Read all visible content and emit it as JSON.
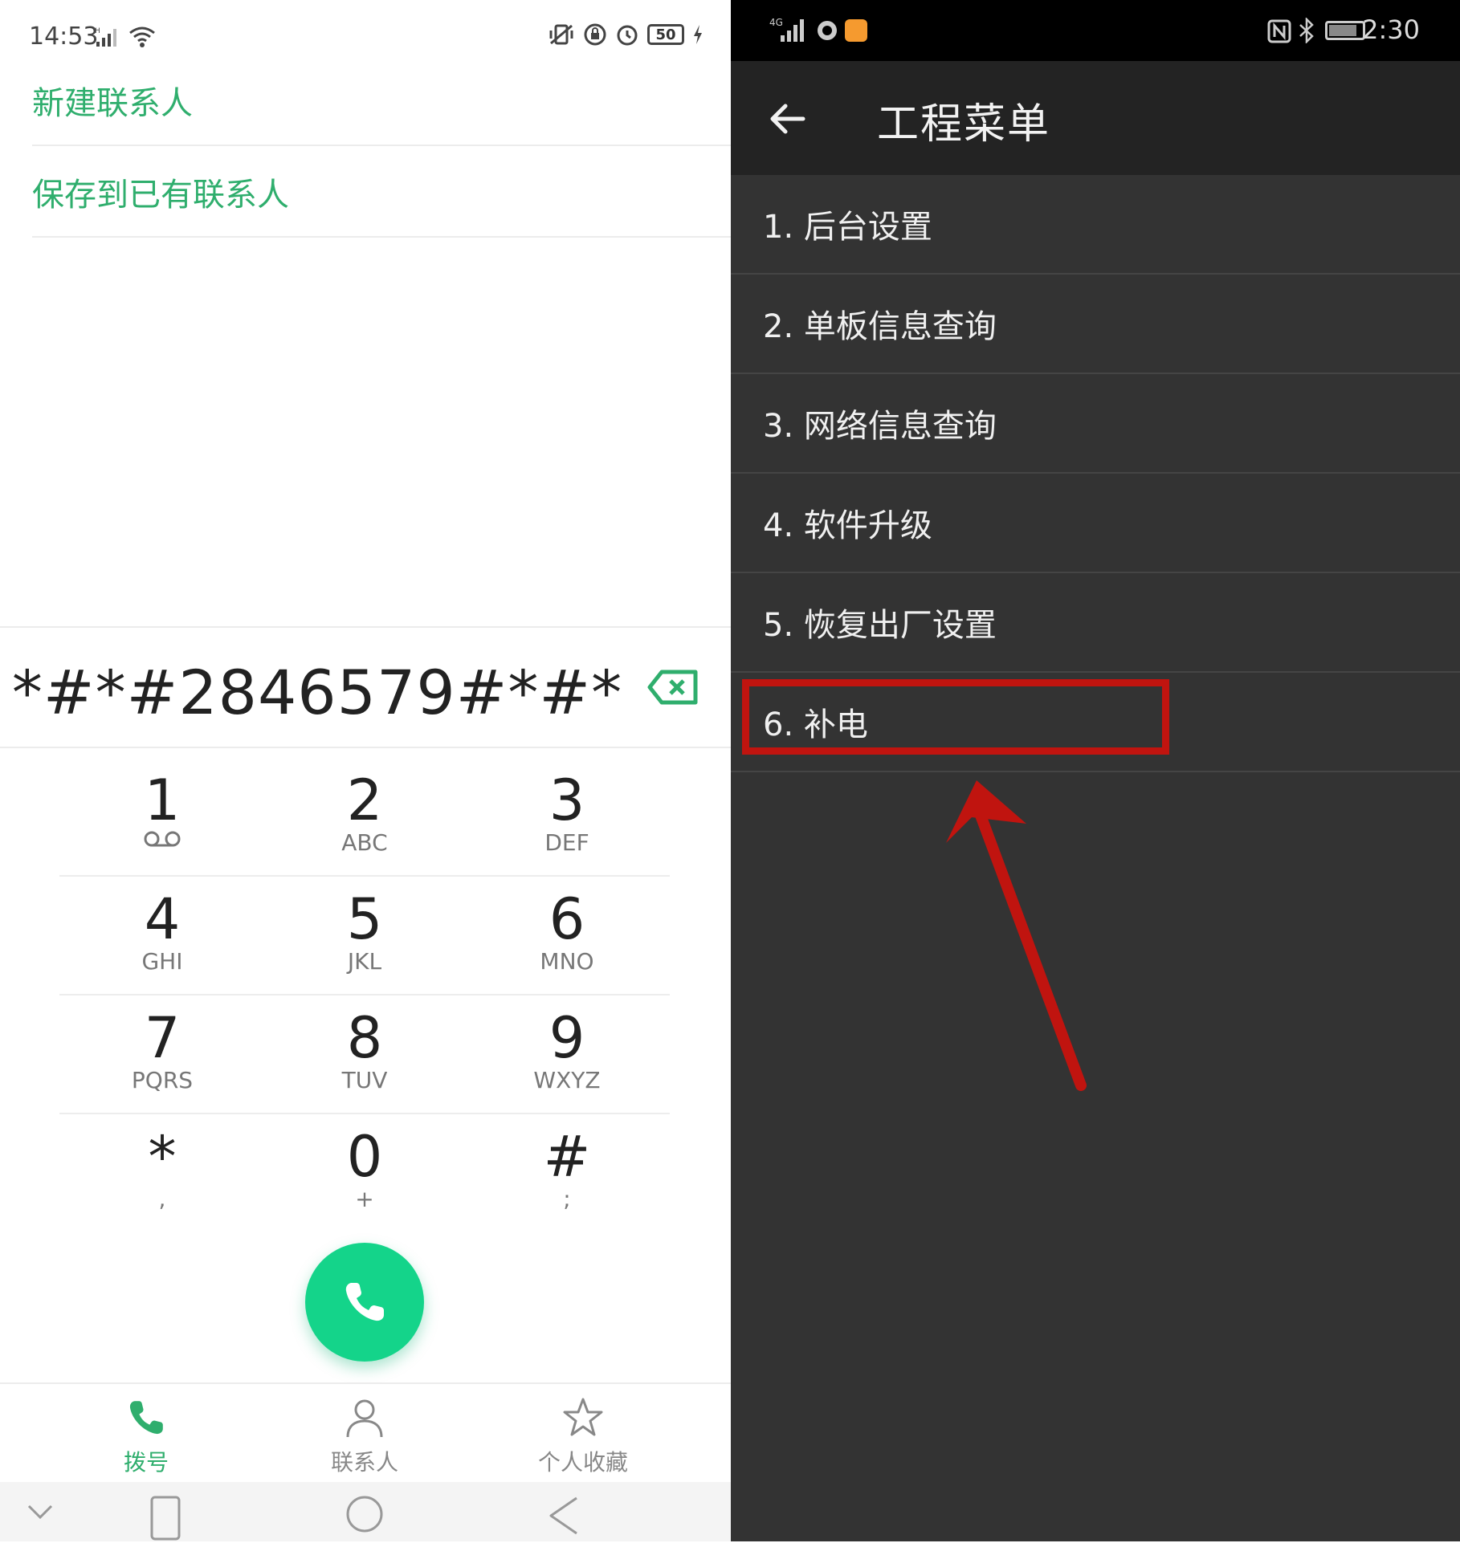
{
  "left": {
    "status": {
      "time": "14:53",
      "battery": "50"
    },
    "actions": {
      "new_contact": "新建联系人",
      "save_existing": "保存到已有联系人"
    },
    "dialer": {
      "number": "*#*#2846579#*#*",
      "keys": [
        {
          "digit": "1",
          "letters": ""
        },
        {
          "digit": "2",
          "letters": "ABC"
        },
        {
          "digit": "3",
          "letters": "DEF"
        },
        {
          "digit": "4",
          "letters": "GHI"
        },
        {
          "digit": "5",
          "letters": "JKL"
        },
        {
          "digit": "6",
          "letters": "MNO"
        },
        {
          "digit": "7",
          "letters": "PQRS"
        },
        {
          "digit": "8",
          "letters": "TUV"
        },
        {
          "digit": "9",
          "letters": "WXYZ"
        },
        {
          "digit": "*",
          "letters": ","
        },
        {
          "digit": "0",
          "letters": "+"
        },
        {
          "digit": "#",
          "letters": ";"
        }
      ]
    },
    "nav": {
      "dial": "拨号",
      "contacts": "联系人",
      "favorites": "个人收藏"
    },
    "colors": {
      "accent": "#2fae6d",
      "call_button": "#14d48a"
    }
  },
  "right": {
    "status": {
      "time": "2:30"
    },
    "title": "工程菜单",
    "menu": [
      "1. 后台设置",
      "2. 单板信息查询",
      "3. 网络信息查询",
      "4. 软件升级",
      "5. 恢复出厂设置",
      "6. 补电"
    ],
    "colors": {
      "background": "#333333",
      "highlight": "#c0140f"
    }
  }
}
